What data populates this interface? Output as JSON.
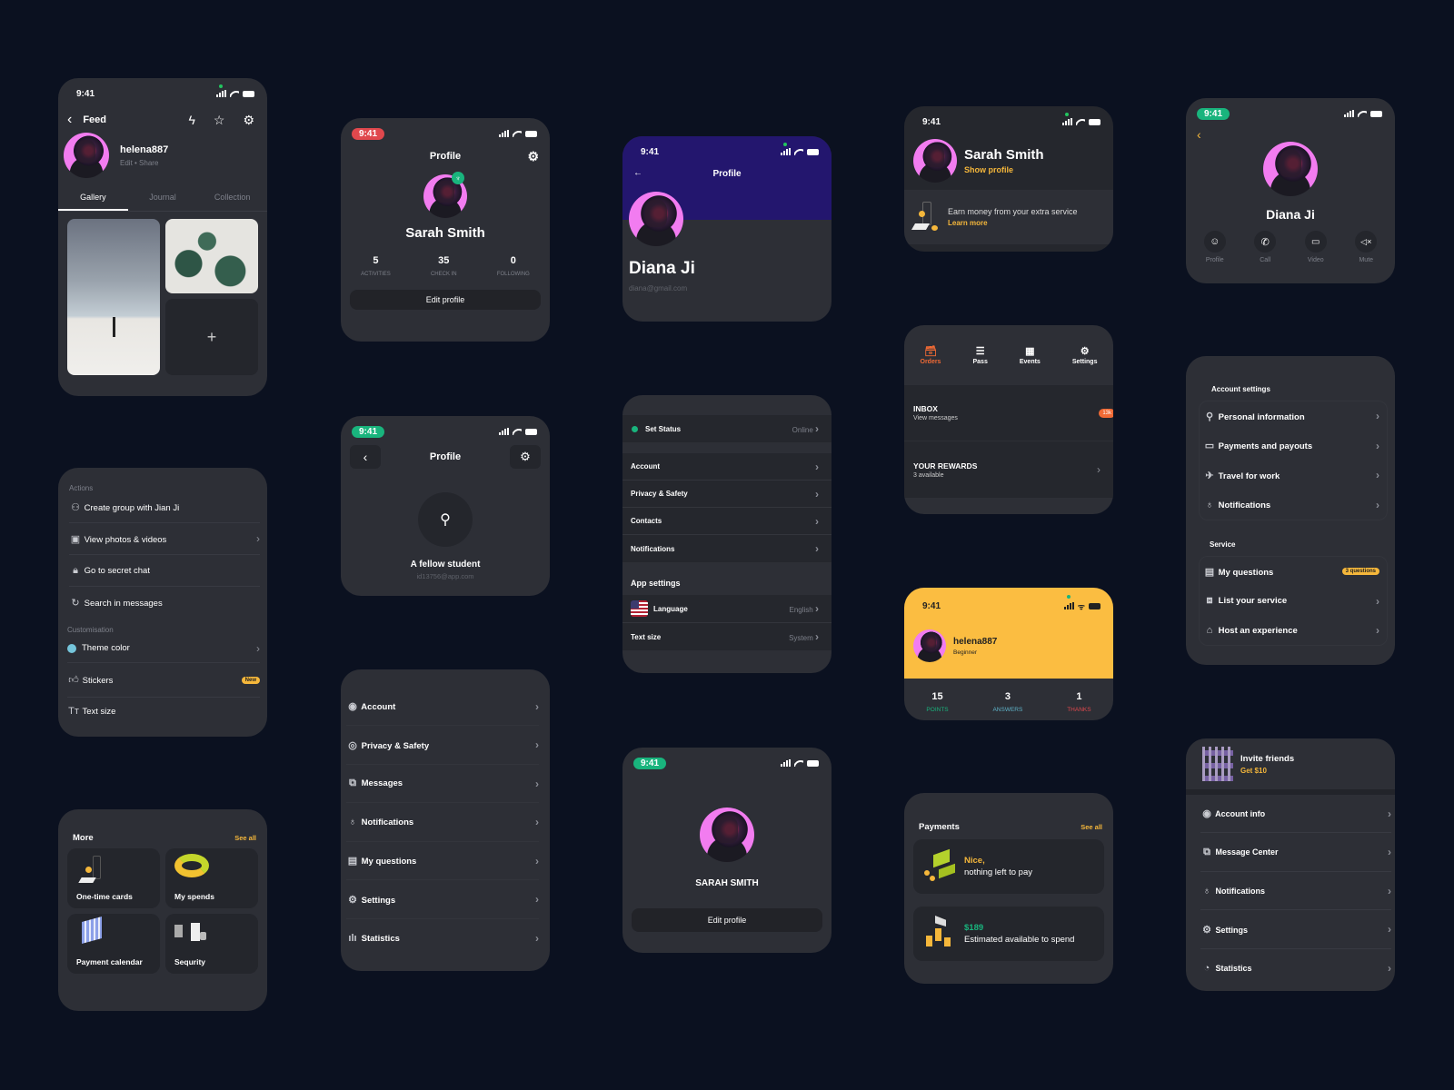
{
  "status_time": "9:41",
  "colors": {
    "background": "#0b1120",
    "card": "#2d2f36",
    "accent_yellow": "#f5b73b",
    "accent_green": "#19b47d",
    "accent_red": "#e0484d",
    "accent_orange": "#f06a35",
    "header_purple": "#23166e"
  },
  "feed": {
    "title": "Feed",
    "username": "helena887",
    "edit": "Edit",
    "share": "Share",
    "tabs": [
      "Gallery",
      "Journal",
      "Collection"
    ],
    "add_label": "+"
  },
  "profile_stats": {
    "title": "Profile",
    "name": "Sarah Smith",
    "stats": [
      {
        "value": "5",
        "label": "ACTIVITIES"
      },
      {
        "value": "35",
        "label": "CHECK IN"
      },
      {
        "value": "0",
        "label": "FOLLOWING"
      }
    ],
    "edit_button": "Edit profile"
  },
  "diana_header": {
    "title": "Profile",
    "name": "Diana Ji",
    "email": "diana@gmail.com"
  },
  "sarah_show": {
    "name": "Sarah Smith",
    "show_profile": "Show profile",
    "promo_text": "Earn money from your extra service",
    "promo_link": "Learn more"
  },
  "diana_contact": {
    "name": "Diana Ji",
    "actions": [
      {
        "label": "Profile",
        "icon": "ghost-icon"
      },
      {
        "label": "Call",
        "icon": "phone-icon"
      },
      {
        "label": "Video",
        "icon": "video-icon"
      },
      {
        "label": "Mute",
        "icon": "mute-icon"
      }
    ]
  },
  "actions_menu": {
    "section1": "Actions",
    "items": [
      {
        "label": "Create group with Jian Ji",
        "icon": "group-icon",
        "chevron": false
      },
      {
        "label": "View photos & videos",
        "icon": "image-icon",
        "chevron": true
      },
      {
        "label": "Go to secret chat",
        "icon": "lock-icon",
        "chevron": false
      },
      {
        "label": "Search in messages",
        "icon": "search-chat-icon",
        "chevron": false
      }
    ],
    "section2": "Customisation",
    "custom_items": [
      {
        "label": "Theme color",
        "icon": "color-dot-icon",
        "chevron": true
      },
      {
        "label": "Stickers",
        "icon": "thumbs-up-icon",
        "badge": "New"
      },
      {
        "label": "Text size",
        "icon": "text-size-icon"
      }
    ]
  },
  "student_profile": {
    "title": "Profile",
    "name": "A fellow student",
    "email": "id13756@app.com"
  },
  "settings_list": {
    "items": [
      {
        "label": "Account",
        "icon": "account-icon"
      },
      {
        "label": "Privacy & Safety",
        "icon": "privacy-icon"
      },
      {
        "label": "Messages",
        "icon": "messages-icon"
      },
      {
        "label": "Notifications",
        "icon": "bulb-icon"
      },
      {
        "label": "My questions",
        "icon": "clipboard-icon"
      },
      {
        "label": "Settings",
        "icon": "gear-icon"
      },
      {
        "label": "Statistics",
        "icon": "stats-icon"
      }
    ]
  },
  "status_settings": {
    "set_status": "Set Status",
    "status_value": "Online",
    "items": [
      "Account",
      "Privacy & Safety",
      "Contacts",
      "Notifications"
    ],
    "app_settings": "App settings",
    "language_label": "Language",
    "language_value": "English",
    "text_size_label": "Text size",
    "text_size_value": "System"
  },
  "orders_nav": {
    "tabs": [
      {
        "label": "Orders",
        "icon": "archive-icon",
        "active": true
      },
      {
        "label": "Pass",
        "icon": "pass-icon"
      },
      {
        "label": "Events",
        "icon": "calendar-icon"
      },
      {
        "label": "Settings",
        "icon": "gear-icon"
      }
    ],
    "inbox_title": "INBOX",
    "inbox_sub": "View messages",
    "inbox_badge": "13k",
    "rewards_title": "YOUR REWARDS",
    "rewards_sub": "3 available"
  },
  "account_settings": {
    "section1": "Account settings",
    "items1": [
      {
        "label": "Personal information",
        "icon": "user-icon"
      },
      {
        "label": "Payments and payouts",
        "icon": "card-icon"
      },
      {
        "label": "Travel for work",
        "icon": "plane-icon"
      },
      {
        "label": "Notifications",
        "icon": "bulb-icon"
      }
    ],
    "section2": "Service",
    "items2": [
      {
        "label": "My questions",
        "icon": "clipboard-icon",
        "badge": "3 questions"
      },
      {
        "label": "List your service",
        "icon": "blocks-icon"
      },
      {
        "label": "Host an experience",
        "icon": "home-icon"
      }
    ]
  },
  "more_grid": {
    "title": "More",
    "see_all": "See all",
    "tiles": [
      "One-time cards",
      "My spends",
      "Payment calendar",
      "Sequrity"
    ]
  },
  "diana_edit": {
    "name": "SARAH SMITH",
    "edit_button": "Edit profile"
  },
  "helena_points": {
    "username": "helena887",
    "level": "Beginner",
    "stats": [
      {
        "value": "15",
        "label": "POINTS",
        "color": "#19b47d"
      },
      {
        "value": "3",
        "label": "ANSWERS",
        "color": "#5fb3c9"
      },
      {
        "value": "1",
        "label": "THANKS",
        "color": "#e0484d"
      }
    ]
  },
  "payments": {
    "title": "Payments",
    "see_all": "See all",
    "card1_title": "Nice,",
    "card1_sub": "nothing left to pay",
    "card2_title": "$189",
    "card2_sub": "Estimated available to spend"
  },
  "invite_menu": {
    "invite_title": "Invite friends",
    "invite_sub": "Get $10",
    "items": [
      {
        "label": "Account info",
        "icon": "account-icon"
      },
      {
        "label": "Message Center",
        "icon": "messages-icon"
      },
      {
        "label": "Notifications",
        "icon": "bulb-icon"
      },
      {
        "label": "Settings",
        "icon": "gear-icon"
      },
      {
        "label": "Statistics",
        "icon": "pie-icon"
      }
    ]
  }
}
